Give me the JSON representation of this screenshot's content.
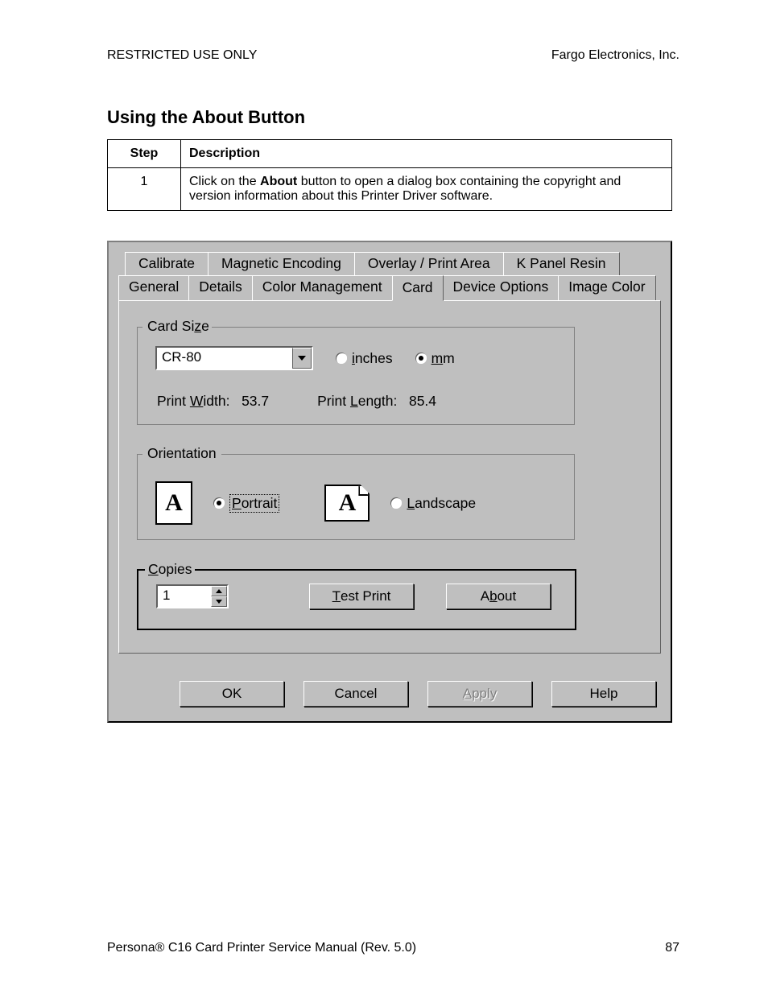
{
  "header": {
    "left": "RESTRICTED USE ONLY",
    "right": "Fargo Electronics, Inc."
  },
  "heading": "Using the About Button",
  "table": {
    "cols": {
      "step": "Step",
      "desc": "Description"
    },
    "rows": [
      {
        "step": "1",
        "desc_pre": "Click on the ",
        "desc_strong": "About",
        "desc_post": " button to open a dialog box containing the copyright and version information about this Printer Driver software."
      }
    ]
  },
  "dialog": {
    "tabs_top": [
      "Calibrate",
      "Magnetic Encoding",
      "Overlay / Print Area",
      "K Panel Resin"
    ],
    "tabs_bot": [
      "General",
      "Details",
      "Color Management",
      "Card",
      "Device Options",
      "Image Color"
    ],
    "active_tab": "Card",
    "card_size": {
      "legend_pre": "Card Si",
      "legend_u": "z",
      "legend_post": "e",
      "combo_value": "CR-80",
      "unit_inches_u": "i",
      "unit_inches_post": "nches",
      "unit_mm_u": "m",
      "unit_mm_post": "m",
      "unit_selected": "mm",
      "width_label_pre": "Print ",
      "width_label_u": "W",
      "width_label_post": "idth:",
      "width_value": "53.7",
      "length_label_pre": "Print ",
      "length_label_u": "L",
      "length_label_post": "ength:",
      "length_value": "85.4"
    },
    "orientation": {
      "legend": "Orientation",
      "portrait_u": "P",
      "portrait_post": "ortrait",
      "landscape_u": "L",
      "landscape_post": "andscape",
      "selected": "portrait",
      "icon_letter": "A"
    },
    "copies": {
      "legend_u": "C",
      "legend_post": "opies",
      "value": "1",
      "test_btn_u": "T",
      "test_btn_post": "est Print",
      "about_btn_pre": "A",
      "about_btn_u": "b",
      "about_btn_post": "out"
    },
    "buttons": {
      "ok": "OK",
      "cancel": "Cancel",
      "apply_u": "A",
      "apply_post": "pply",
      "help": "Help"
    }
  },
  "footer": {
    "left_pre": "Persona",
    "left_reg": "®",
    "left_post": " C16 Card Printer Service Manual (Rev. 5.0)",
    "page": "87"
  }
}
